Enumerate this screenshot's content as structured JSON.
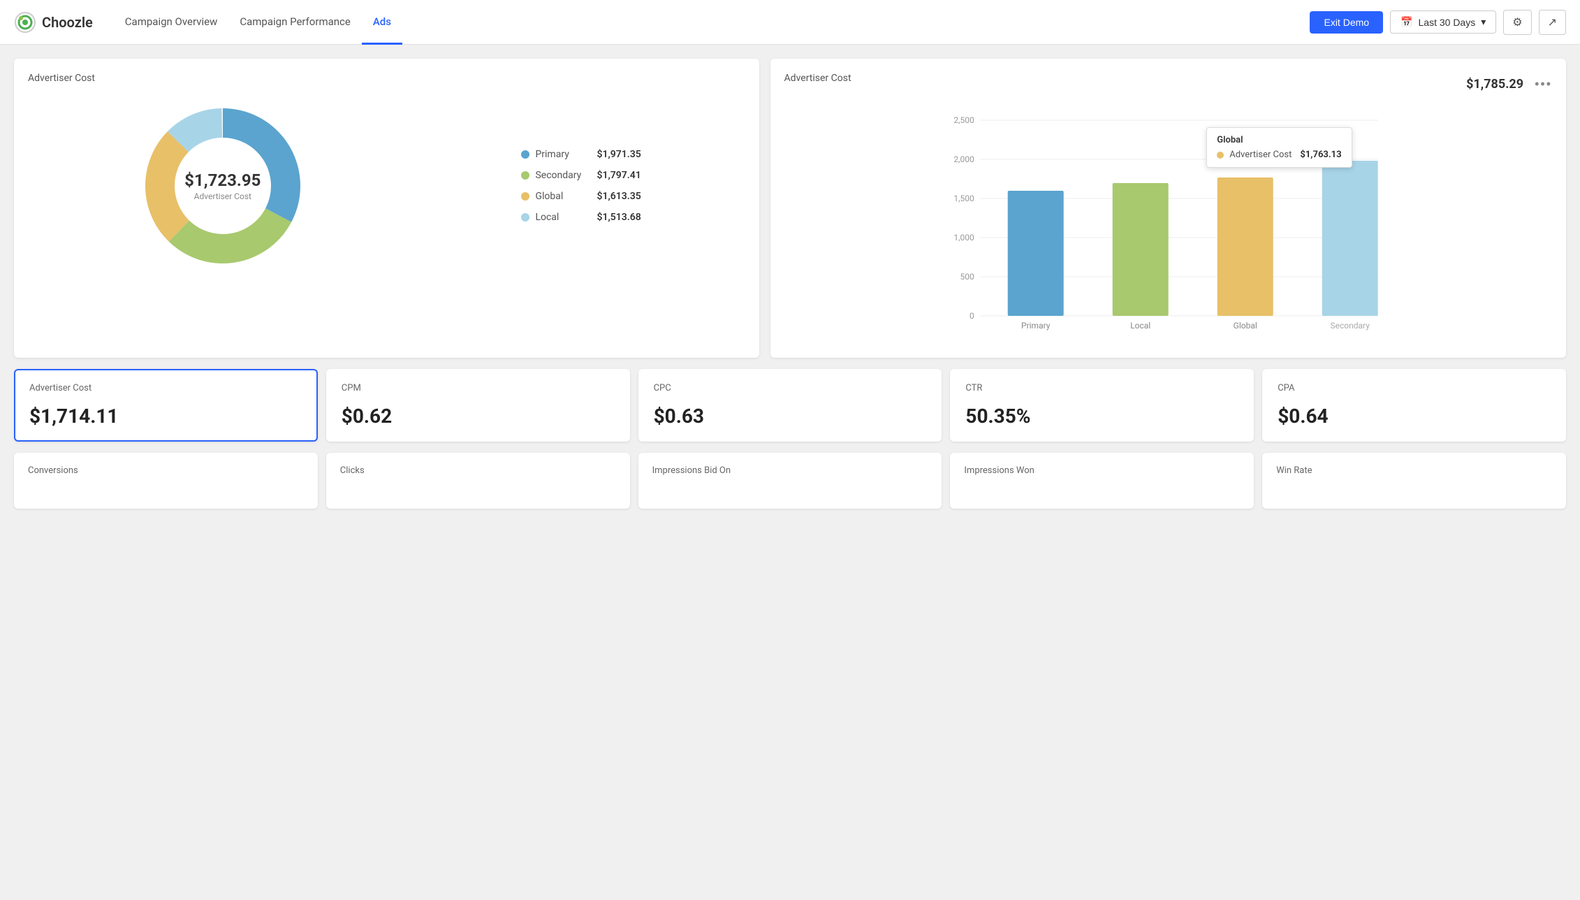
{
  "header": {
    "logo_text": "Choozle",
    "nav_tabs": [
      {
        "id": "campaign-overview",
        "label": "Campaign Overview",
        "active": false
      },
      {
        "id": "campaign-performance",
        "label": "Campaign Performance",
        "active": false
      },
      {
        "id": "ads",
        "label": "Ads",
        "active": true
      }
    ],
    "exit_demo_label": "Exit Demo",
    "date_picker_label": "Last 30 Days",
    "filter_icon": "≡",
    "share_icon": "⤢"
  },
  "donut_chart": {
    "title": "Advertiser Cost",
    "center_value": "$1,723.95",
    "center_label": "Advertiser Cost",
    "legend": [
      {
        "name": "Primary",
        "value": "$1,971.35",
        "color": "#5BA4CF"
      },
      {
        "name": "Secondary",
        "value": "$1,797.41",
        "color": "#A8C96E"
      },
      {
        "name": "Global",
        "value": "$1,613.35",
        "color": "#E8C068"
      },
      {
        "name": "Local",
        "value": "$1,513.68",
        "color": "#A8D4E8"
      }
    ]
  },
  "bar_chart": {
    "title": "Advertiser Cost",
    "total": "$1,785.29",
    "more_icon": "•••",
    "bars": [
      {
        "label": "Primary",
        "value": 1600,
        "color": "#5BA4CF"
      },
      {
        "label": "Local",
        "value": 1700,
        "color": "#A8C96E"
      },
      {
        "label": "Global",
        "value": 1763,
        "color": "#E8C068"
      },
      {
        "label": "Secondary",
        "value": 1980,
        "color": "#A8D4E8"
      }
    ],
    "y_labels": [
      "0",
      "500",
      "1,000",
      "1,500",
      "2,000",
      "2,500"
    ],
    "tooltip": {
      "title": "Global",
      "metric": "Advertiser Cost",
      "value": "$1,763.13",
      "color": "#E8C068"
    }
  },
  "metric_cards": [
    {
      "id": "advertiser-cost",
      "label": "Advertiser Cost",
      "value": "$1,714.11",
      "active": true
    },
    {
      "id": "cpm",
      "label": "CPM",
      "value": "$0.62",
      "active": false
    },
    {
      "id": "cpc",
      "label": "CPC",
      "value": "$0.63",
      "active": false
    },
    {
      "id": "ctr",
      "label": "CTR",
      "value": "50.35%",
      "active": false
    },
    {
      "id": "cpa",
      "label": "CPA",
      "value": "$0.64",
      "active": false
    }
  ],
  "bottom_cards": [
    {
      "id": "conversions",
      "label": "Conversions"
    },
    {
      "id": "clicks",
      "label": "Clicks"
    },
    {
      "id": "impressions-bid-on",
      "label": "Impressions Bid On"
    },
    {
      "id": "impressions-won",
      "label": "Impressions Won"
    },
    {
      "id": "win-rate",
      "label": "Win Rate"
    }
  ]
}
